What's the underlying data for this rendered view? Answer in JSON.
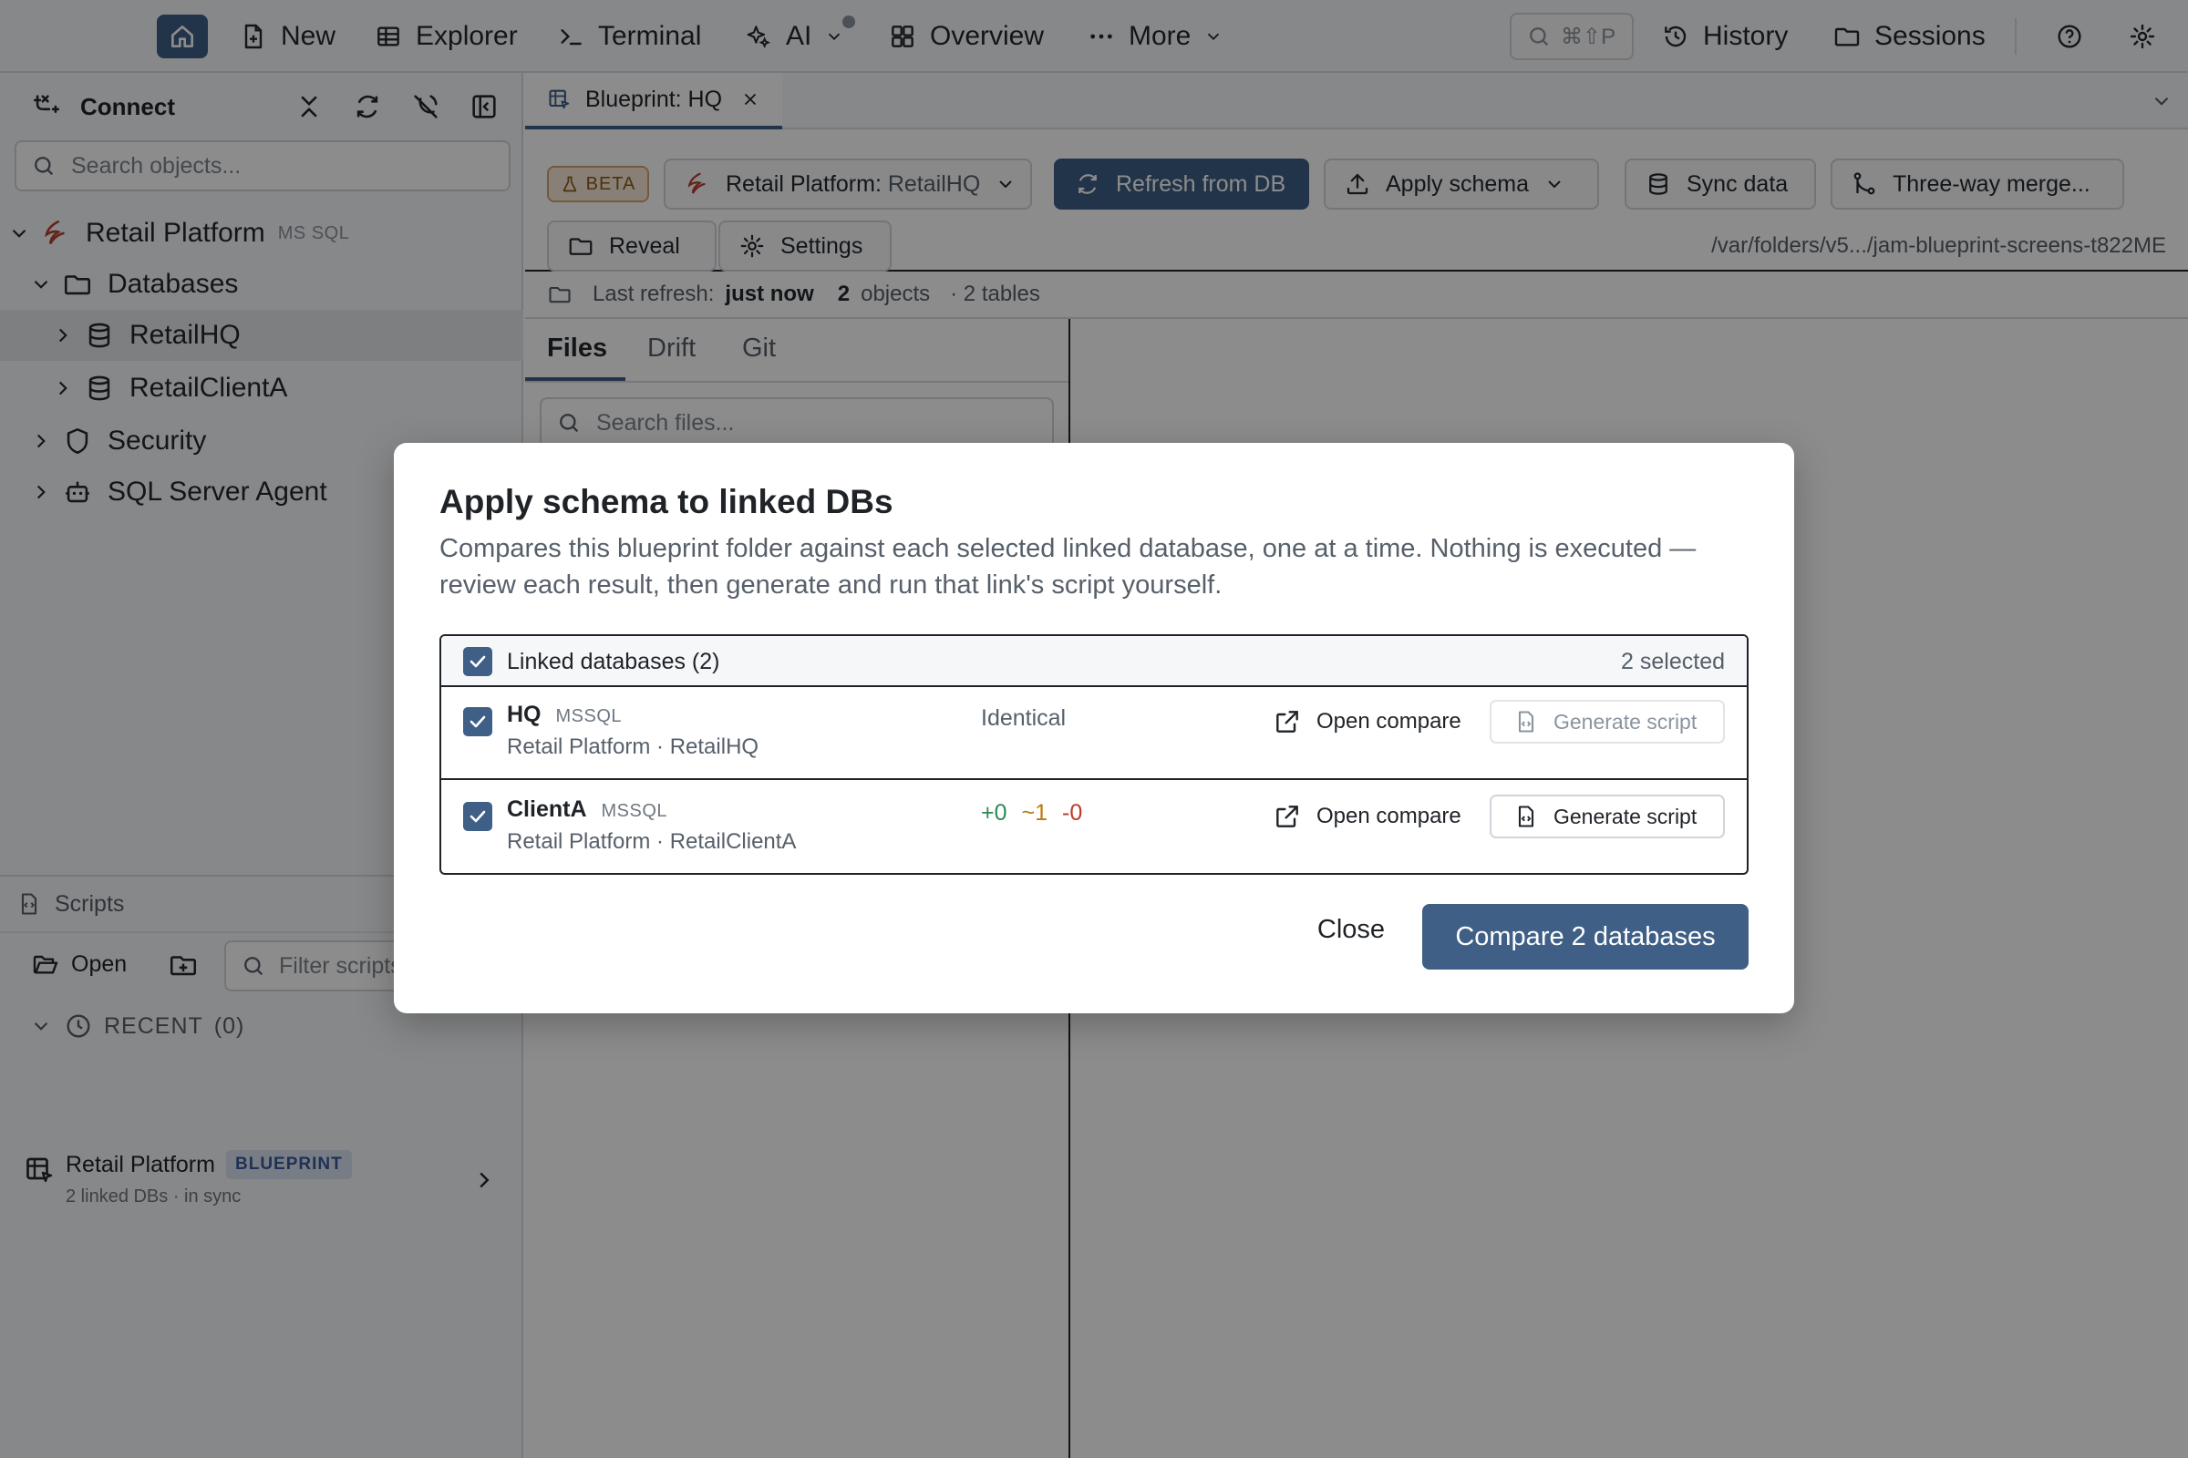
{
  "topbar": {
    "new_label": "New",
    "explorer_label": "Explorer",
    "terminal_label": "Terminal",
    "ai_label": "AI",
    "overview_label": "Overview",
    "more_label": "More",
    "search_shortcut": "⌘⇧P",
    "history_label": "History",
    "sessions_label": "Sessions"
  },
  "sidebar": {
    "connect_label": "Connect",
    "search_placeholder": "Search objects...",
    "tree": {
      "server": "Retail Platform",
      "server_engine": "MS SQL",
      "databases": "Databases",
      "db1": "RetailHQ",
      "db2": "RetailClientA",
      "security": "Security",
      "agent": "SQL Server Agent"
    },
    "scripts": {
      "title": "Scripts",
      "open_label": "Open",
      "filter_placeholder": "Filter scripts",
      "recent_label": "RECENT",
      "recent_count": "(0)",
      "blueprint_name": "Retail Platform",
      "blueprint_badge": "BLUEPRINT",
      "blueprint_sub": "2 linked DBs · in sync"
    }
  },
  "main": {
    "tab_title": "Blueprint: HQ",
    "beta_label": "BETA",
    "target_prefix": "Retail Platform:",
    "target_db": "RetailHQ",
    "refresh_label": "Refresh from DB",
    "apply_label": "Apply schema",
    "sync_label": "Sync data",
    "merge_label": "Three-way merge...",
    "reveal_label": "Reveal",
    "settings_label": "Settings",
    "path": "/var/folders/v5.../jam-blueprint-screens-t822ME",
    "status": {
      "refresh_prefix": "Last refresh:",
      "refresh_value": "just now",
      "objects_count": "2",
      "objects_label": "objects",
      "tables": "· 2 tables"
    },
    "files_tabs": [
      "Files",
      "Drift",
      "Git"
    ],
    "files_search_placeholder": "Search files..."
  },
  "modal": {
    "title": "Apply schema to linked DBs",
    "description": "Compares this blueprint folder against each selected linked database, one at a time. Nothing is executed — review each result, then generate and run that link's script yourself.",
    "header_label": "Linked databases (2)",
    "selected_label": "2 selected",
    "rows": [
      {
        "name": "HQ",
        "engine": "MSSQL",
        "path": "Retail Platform · RetailHQ",
        "result": "Identical",
        "open_label": "Open compare",
        "generate_label": "Generate script"
      },
      {
        "name": "ClientA",
        "engine": "MSSQL",
        "path": "Retail Platform · RetailClientA",
        "diff_added": "+0",
        "diff_changed": "~1",
        "diff_removed": "-0",
        "open_label": "Open compare",
        "generate_label": "Generate script"
      }
    ],
    "close_label": "Close",
    "compare_label": "Compare 2 databases"
  },
  "colors": {
    "accent": "#3f5f86",
    "diff_added": "#2a8a55",
    "diff_changed": "#b97a10",
    "diff_removed": "#c0392b",
    "blueprint_badge_bg": "#dbe4f3",
    "blueprint_badge_fg": "#3a5a9b"
  }
}
